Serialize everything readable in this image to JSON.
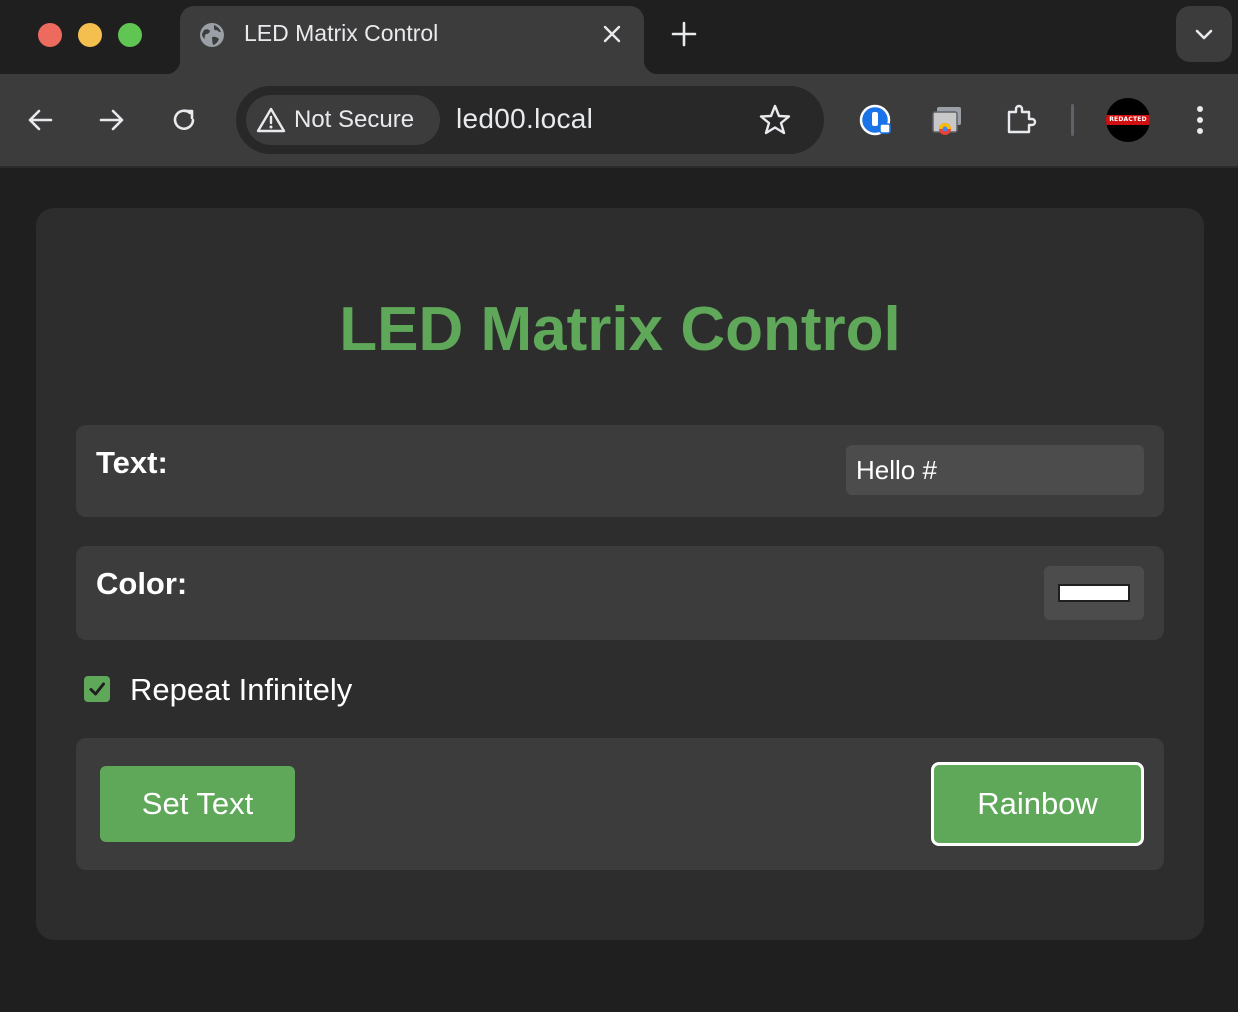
{
  "window": {
    "traffic_lights": [
      "close",
      "minimize",
      "maximize"
    ]
  },
  "tab": {
    "title": "LED Matrix Control",
    "icon": "globe-icon",
    "close_icon": "close-icon"
  },
  "toolbar": {
    "security_chip": "Not Secure",
    "url": "led00.local",
    "avatar_label": "REDACTED"
  },
  "page": {
    "heading": "LED Matrix Control",
    "text_label": "Text:",
    "text_value": "Hello #",
    "color_label": "Color:",
    "color_value": "#ffffff",
    "repeat_label": "Repeat Infinitely",
    "repeat_checked": true,
    "set_text_button": "Set Text",
    "rainbow_button": "Rainbow"
  },
  "colors": {
    "accent_green": "#5fa85a",
    "card_bg": "#2d2d2d",
    "row_bg": "#3c3c3c",
    "page_bg": "#1f1f1f"
  }
}
